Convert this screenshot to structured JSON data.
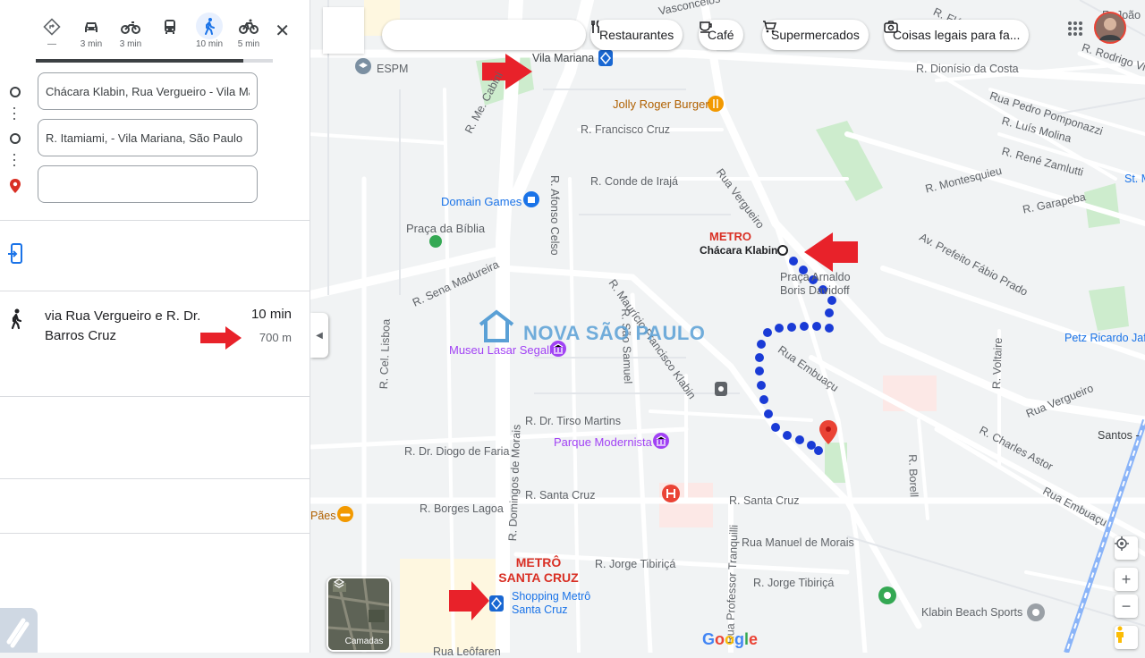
{
  "travel_modes": [
    {
      "name": "driving-best",
      "time": "—"
    },
    {
      "name": "driving",
      "time": "3 min"
    },
    {
      "name": "motorcycle",
      "time": "3 min"
    },
    {
      "name": "transit",
      "time": ""
    },
    {
      "name": "walking",
      "time": "10 min"
    },
    {
      "name": "cycling",
      "time": "5 min"
    }
  ],
  "origin": "Chácara Klabin, Rua Vergueiro - Vila Mari",
  "destination": "R. Itamiami,  - Vila Mariana, São Paulo",
  "extra_stop": "",
  "route": {
    "via": "via Rua Vergueiro e R. Dr. Barros Cruz",
    "time": "10 min",
    "distance": "700 m"
  },
  "search_placeholder": "",
  "chips": [
    "Restaurantes",
    "Café",
    "Supermercados",
    "Coisas legais para fa..."
  ],
  "map_labels": {
    "espm": "ESPM",
    "vila_mariana": "Vila Mariana",
    "jolly": "Jolly Roger Burger",
    "r_francisco_cruz": "R. Francisco Cruz",
    "r_me_cabini": "R. Me. Cabini",
    "r_conde_iraja": "R. Conde de Irajá",
    "r_afonso_celso": "R. Afonso Celso",
    "domain_games": "Domain Games",
    "praca_biblia": "Praça da Bíblia",
    "r_sena_madureira": "R. Sena Madureira",
    "rua_vergueiro": "Rua Vergueiro",
    "metro_label": "METRO",
    "chacara_klabin": "Chácara Klabin",
    "praca_arnaldo": "Praça Arnaldo",
    "boris": "Boris Davidoff",
    "r_mauricio": "R. Maurício Francisco Klabin",
    "r_cel_lisboa": "R. Cel. Lisboa",
    "museu": "Museu Lasar Segall",
    "r_sao_samuel": "R. São Samuel",
    "rua_embuacu": "Rua Embuaçu",
    "r_dr_tirso": "R. Dr. Tirso Martins",
    "parque_modernista": "Parque Modernista",
    "r_diogo_faria": "R. Dr. Diogo de Faria",
    "r_domingos": "R. Domingos de Morais",
    "r_santa_cruz": "R. Santa Cruz",
    "r_santa_cruz2": "R. Santa Cruz",
    "r_borges_lagoa": "R. Borges Lagoa",
    "paes": "Pães",
    "r_jorge_tibirica": "R. Jorge Tibiriçá",
    "r_jorge_tibirica2": "R. Jorge Tibiriçá",
    "rua_manuel": "Rua Manuel de Morais",
    "rua_prof": "Rua Professor Tranquilli",
    "metro_santa_cruz": "METRÔ SANTA CRUZ",
    "shopping": "Shopping Metrô Santa Cruz",
    "r_leofaren": "Rua Leôfaren",
    "klabin_beach": "Klabin Beach Sports",
    "r_dionisio": "R. Dionísio da Costa",
    "rua_pedro": "Rua Pedro Pomponazzi",
    "r_luis_molina": "R. Luís Molina",
    "r_rene": "R. René Zamlutti",
    "r_montesquieu": "R. Montesquieu",
    "r_garapeba": "R. Garapeba",
    "av_prefeito": "Av. Prefeito Fábio Prado",
    "petz": "Petz Ricardo Jafet",
    "r_voltaire": "R. Voltaire",
    "rua_vergueiro2": "Rua Vergueiro",
    "r_charles": "R. Charles Astor",
    "santos": "Santos -",
    "rua_embuacu2": "Rua Embuaçu",
    "r_borell": "R. Borell",
    "r_rodrigo": "R. Rodrigo Vieira",
    "r_joao": "R. João",
    "vasconcelos": "Vasconcelos",
    "r_flavi": "R. Flávi",
    "st_m": "St. M",
    "watermark": "NOVA SÃO PAULO",
    "camadas": "Camadas",
    "google": "Google"
  },
  "colors": {
    "route": "#1a3bd6",
    "arrow": "#e8222a",
    "road": "#ffffff",
    "map_bg": "#f1f3f4",
    "park": "#cdeccd",
    "accent": "#1a73e8"
  }
}
